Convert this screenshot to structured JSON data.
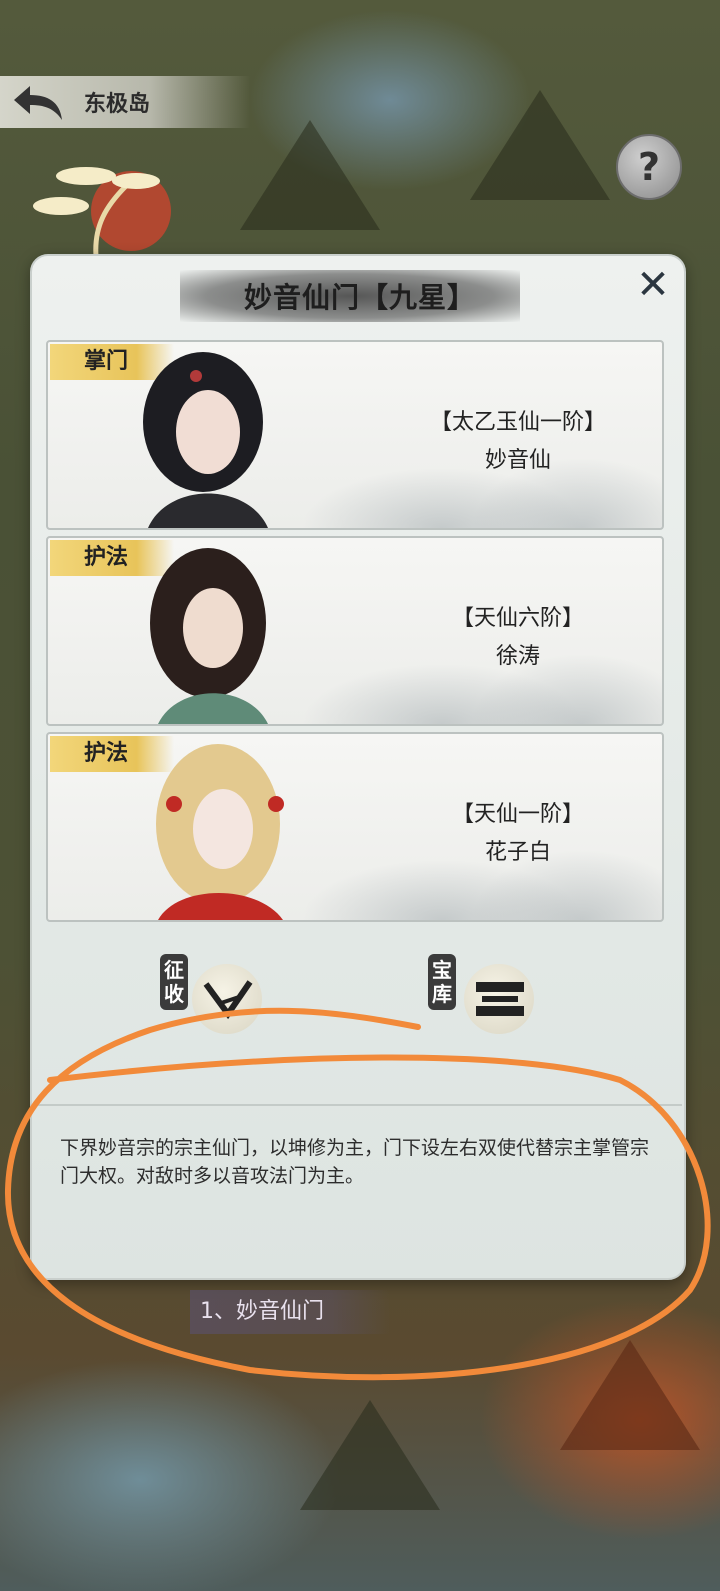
{
  "header": {
    "region": "东极岛",
    "help_symbol": "?"
  },
  "panel": {
    "title": "妙音仙门【九星】",
    "close_symbol": "✕",
    "members": [
      {
        "role": "掌门",
        "rank": "【太乙玉仙一阶】",
        "name": "妙音仙"
      },
      {
        "role": "护法",
        "rank": "【天仙六阶】",
        "name": "徐涛"
      },
      {
        "role": "护法",
        "rank": "【天仙一阶】",
        "name": "花子白"
      }
    ],
    "actions": [
      {
        "label": "征收",
        "icon": "scroll-icon"
      },
      {
        "label": "宝库",
        "icon": "treasure-chest-icon"
      }
    ],
    "description": "下界妙音宗的宗主仙门，以坤修为主，门下设左右双使代替宗主掌管宗门大权。对敌时多以音攻法门为主。"
  },
  "footer": {
    "section_label": "1、妙音仙门"
  },
  "colors": {
    "highlight_ring": "#f28a3a",
    "role_tag": "#e8c45a"
  }
}
